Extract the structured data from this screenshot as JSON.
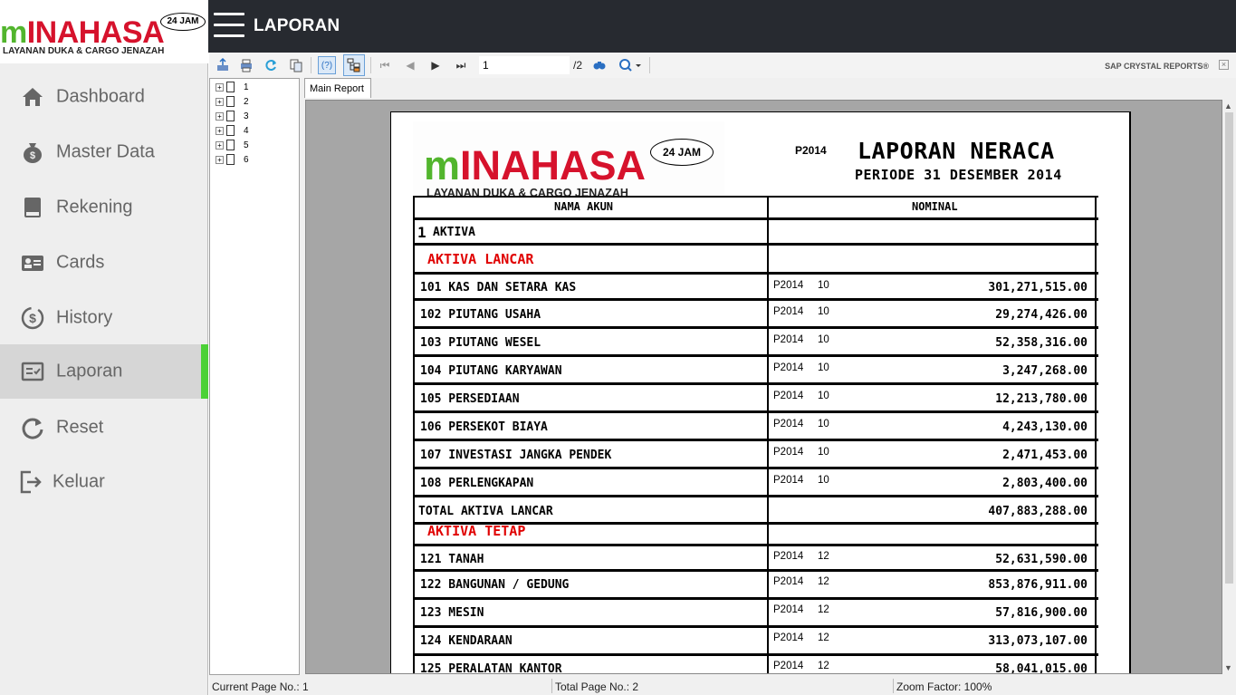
{
  "brand": {
    "name_green": "m",
    "name_red": "INAHASA",
    "badge": "24 JAM",
    "tagline": "LAYANAN DUKA & CARGO JENAZAH"
  },
  "sidebar": {
    "items": [
      {
        "label": "Dashboard",
        "icon": "home-icon"
      },
      {
        "label": "Master Data",
        "icon": "money-bag-icon"
      },
      {
        "label": "Rekening",
        "icon": "book-icon"
      },
      {
        "label": "Cards",
        "icon": "id-card-icon"
      },
      {
        "label": "History",
        "icon": "dollar-history-icon"
      },
      {
        "label": "Laporan",
        "icon": "report-icon",
        "active": true
      },
      {
        "label": "Reset",
        "icon": "refresh-icon"
      },
      {
        "label": "Keluar",
        "icon": "logout-icon"
      }
    ],
    "active_color": "#4cd137"
  },
  "header": {
    "title": "LAPORAN"
  },
  "toolbar": {
    "page_value": "1",
    "page_total": "/2",
    "brand": "SAP CRYSTAL REPORTS®"
  },
  "tree": {
    "nodes": [
      "1",
      "2",
      "3",
      "4",
      "5",
      "6"
    ]
  },
  "tab": {
    "label": "Main Report"
  },
  "report": {
    "code": "P2014",
    "title": "LAPORAN NERACA",
    "period": "PERIODE 31 DESEMBER 2014",
    "col_name": "NAMA AKUN",
    "col_nominal": "NOMINAL",
    "group_num": "1",
    "group": "AKTIVA",
    "section1": "AKTIVA LANCAR",
    "rows1": [
      {
        "name": "101 KAS DAN SETARA KAS",
        "per": "P2014",
        "code": "10",
        "amount": "301,271,515.00"
      },
      {
        "name": "102 PIUTANG USAHA",
        "per": "P2014",
        "code": "10",
        "amount": "29,274,426.00"
      },
      {
        "name": "103 PIUTANG WESEL",
        "per": "P2014",
        "code": "10",
        "amount": "52,358,316.00"
      },
      {
        "name": "104 PIUTANG KARYAWAN",
        "per": "P2014",
        "code": "10",
        "amount": "3,247,268.00"
      },
      {
        "name": "105 PERSEDIAAN",
        "per": "P2014",
        "code": "10",
        "amount": "12,213,780.00"
      },
      {
        "name": "106 PERSEKOT BIAYA",
        "per": "P2014",
        "code": "10",
        "amount": "4,243,130.00"
      },
      {
        "name": "107 INVESTASI JANGKA PENDEK",
        "per": "P2014",
        "code": "10",
        "amount": "2,471,453.00"
      },
      {
        "name": "108 PERLENGKAPAN",
        "per": "P2014",
        "code": "10",
        "amount": "2,803,400.00"
      }
    ],
    "total1_label": "TOTAL AKTIVA LANCAR",
    "total1_amount": "407,883,288.00",
    "section2": "AKTIVA TETAP",
    "rows2": [
      {
        "name": "121 TANAH",
        "per": "P2014",
        "code": "12",
        "amount": "52,631,590.00"
      },
      {
        "name": "122 BANGUNAN / GEDUNG",
        "per": "P2014",
        "code": "12",
        "amount": "853,876,911.00"
      },
      {
        "name": "123 MESIN",
        "per": "P2014",
        "code": "12",
        "amount": "57,816,900.00"
      },
      {
        "name": "124 KENDARAAN",
        "per": "P2014",
        "code": "12",
        "amount": "313,073,107.00"
      },
      {
        "name": "125 PERALATAN KANTOR",
        "per": "P2014",
        "code": "12",
        "amount": "58,041,015.00"
      }
    ]
  },
  "status": {
    "current": "Current Page No.: 1",
    "total": "Total Page No.: 2",
    "zoom": "Zoom Factor: 100%"
  }
}
